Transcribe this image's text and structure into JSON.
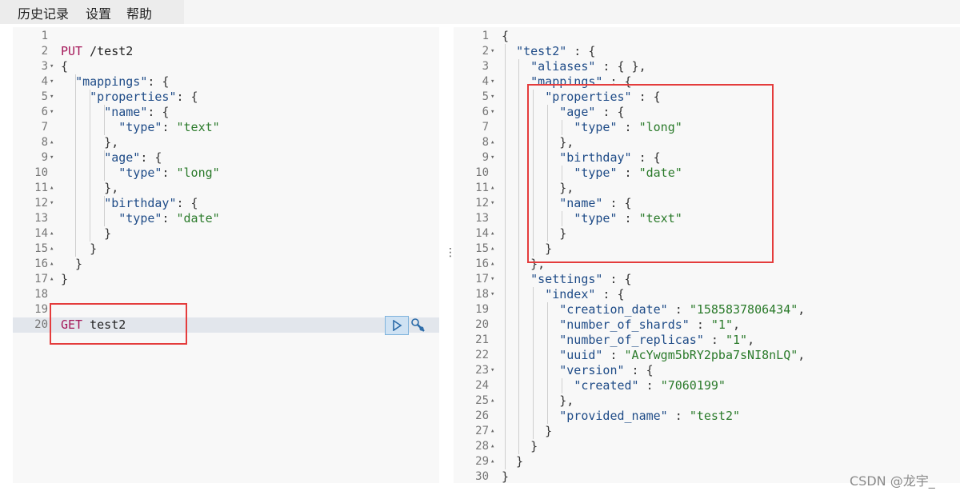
{
  "menu": {
    "items": [
      "历史记录",
      "设置",
      "帮助"
    ]
  },
  "editor": {
    "lines": [
      "",
      "PUT /test2",
      "{",
      "  \"mappings\": {",
      "    \"properties\": {",
      "      \"name\": {",
      "        \"type\": \"text\"",
      "      },",
      "      \"age\": {",
      "        \"type\": \"long\"",
      "      },",
      "      \"birthday\": {",
      "        \"type\": \"date\"",
      "      }",
      "    }",
      "  }",
      "}",
      "",
      "",
      "GET test2"
    ],
    "active_line": 20
  },
  "response": {
    "lines": [
      "{",
      "  \"test2\" : {",
      "    \"aliases\" : { },",
      "    \"mappings\" : {",
      "      \"properties\" : {",
      "        \"age\" : {",
      "          \"type\" : \"long\"",
      "        },",
      "        \"birthday\" : {",
      "          \"type\" : \"date\"",
      "        },",
      "        \"name\" : {",
      "          \"type\" : \"text\"",
      "        }",
      "      }",
      "    },",
      "    \"settings\" : {",
      "      \"index\" : {",
      "        \"creation_date\" : \"1585837806434\",",
      "        \"number_of_shards\" : \"1\",",
      "        \"number_of_replicas\" : \"1\",",
      "        \"uuid\" : \"AcYwgm5bRY2pba7sNI8nLQ\",",
      "        \"version\" : {",
      "          \"created\" : \"7060199\"",
      "        },",
      "        \"provided_name\" : \"test2\"",
      "      }",
      "    }",
      "  }",
      "}"
    ]
  },
  "watermark": "CSDN @龙宇_",
  "colors": {
    "keyword": "#a41658",
    "string": "#2a7a2a",
    "key": "#1e4b87",
    "highlight_box": "#e43c3c"
  },
  "icons": {
    "run": "play-icon",
    "wrench": "wrench-icon",
    "splitter": "vertical-dots-icon"
  }
}
